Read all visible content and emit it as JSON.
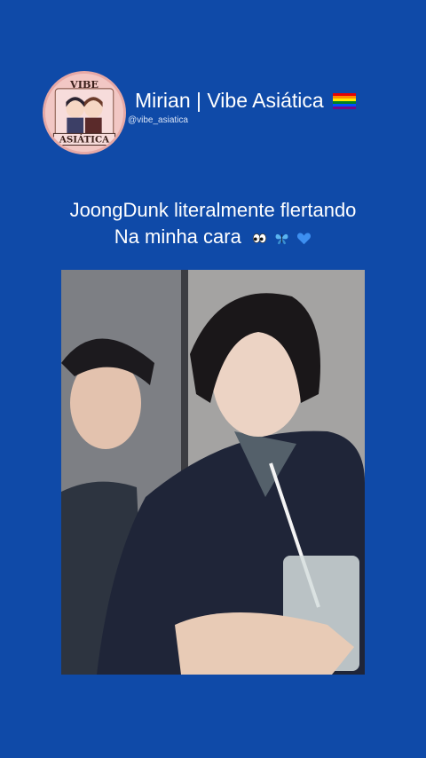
{
  "profile": {
    "display_name": "Mirian | Vibe Asiática",
    "handle": "@vibe_asiatica",
    "avatar_text_top": "VIBE",
    "avatar_text_bottom": "ASIÁTICA",
    "flag_icon": "rainbow-flag-icon"
  },
  "post": {
    "caption_line1": "JoongDunk literalmente flertando",
    "caption_line2": "Na minha cara",
    "caption_emojis": [
      "eyes-icon",
      "butterfly-icon",
      "blue-heart-icon"
    ]
  },
  "colors": {
    "background": "#0f4aa8",
    "text": "#ffffff",
    "avatar_bg": "#f2c7c4"
  }
}
